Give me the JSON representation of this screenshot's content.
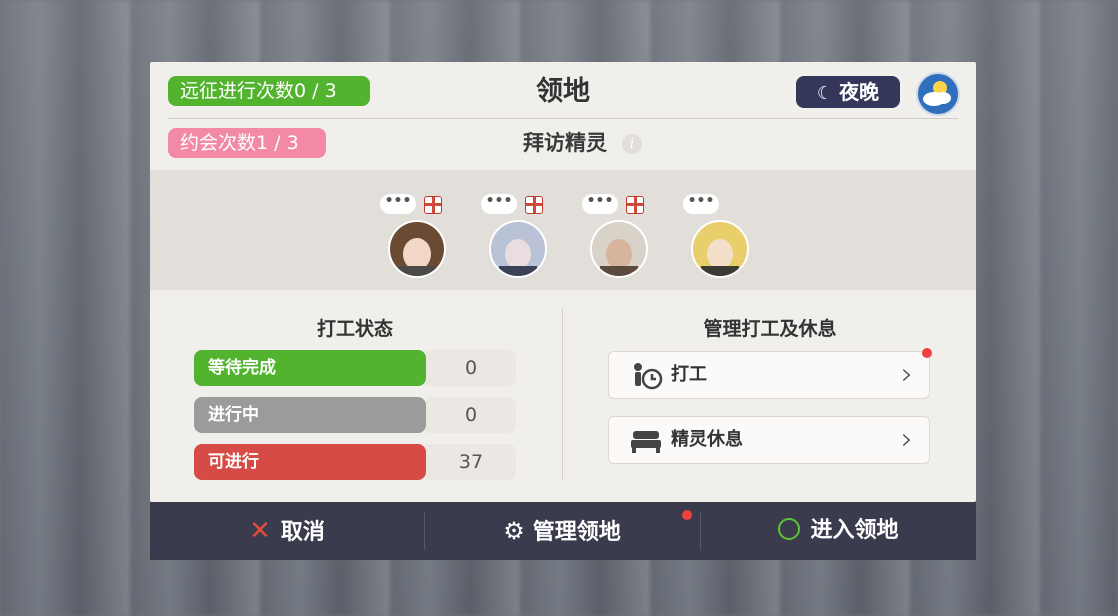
{
  "header": {
    "expedition_count": "远征进行次数0 / 3",
    "date_count": "约会次数1 / 3",
    "title": "领地",
    "time_label": "夜晚",
    "subtitle": "拜访精灵",
    "info_icon": "i"
  },
  "spirits": [
    {
      "bubble": "•••",
      "has_gift": true,
      "colors": {
        "hair": "#6b4a34",
        "skin": "#f2d6c6"
      }
    },
    {
      "bubble": "•••",
      "has_gift": true,
      "colors": {
        "hair": "#b9c2d6",
        "skin": "#eadde0"
      }
    },
    {
      "bubble": "•••",
      "has_gift": true,
      "colors": {
        "hair": "#d9d2c8",
        "skin": "#d7b59c"
      }
    },
    {
      "bubble": "•••",
      "has_gift": false,
      "colors": {
        "hair": "#e9cf6b",
        "skin": "#f3dfc9"
      }
    }
  ],
  "work_status": {
    "title": "打工状态",
    "rows": [
      {
        "label": "等待完成",
        "value": "0",
        "color": "#52b32f"
      },
      {
        "label": "进行中",
        "value": "0",
        "color": "#9b9b9b"
      },
      {
        "label": "可进行",
        "value": "37",
        "color": "#d64b45"
      }
    ]
  },
  "manage": {
    "title": "管理打工及休息",
    "buttons": [
      {
        "label": "打工",
        "icon": "work-timer-icon",
        "has_dot": true
      },
      {
        "label": "精灵休息",
        "icon": "bed-icon",
        "has_dot": false
      }
    ]
  },
  "footer": {
    "cancel": "取消",
    "manage_territory": "管理领地",
    "enter_territory": "进入领地"
  },
  "colors": {
    "accent_green": "#52b32f",
    "accent_pink": "#f28aa5",
    "footer_bg": "#3a3b4c",
    "night_pill": "#35375a"
  }
}
